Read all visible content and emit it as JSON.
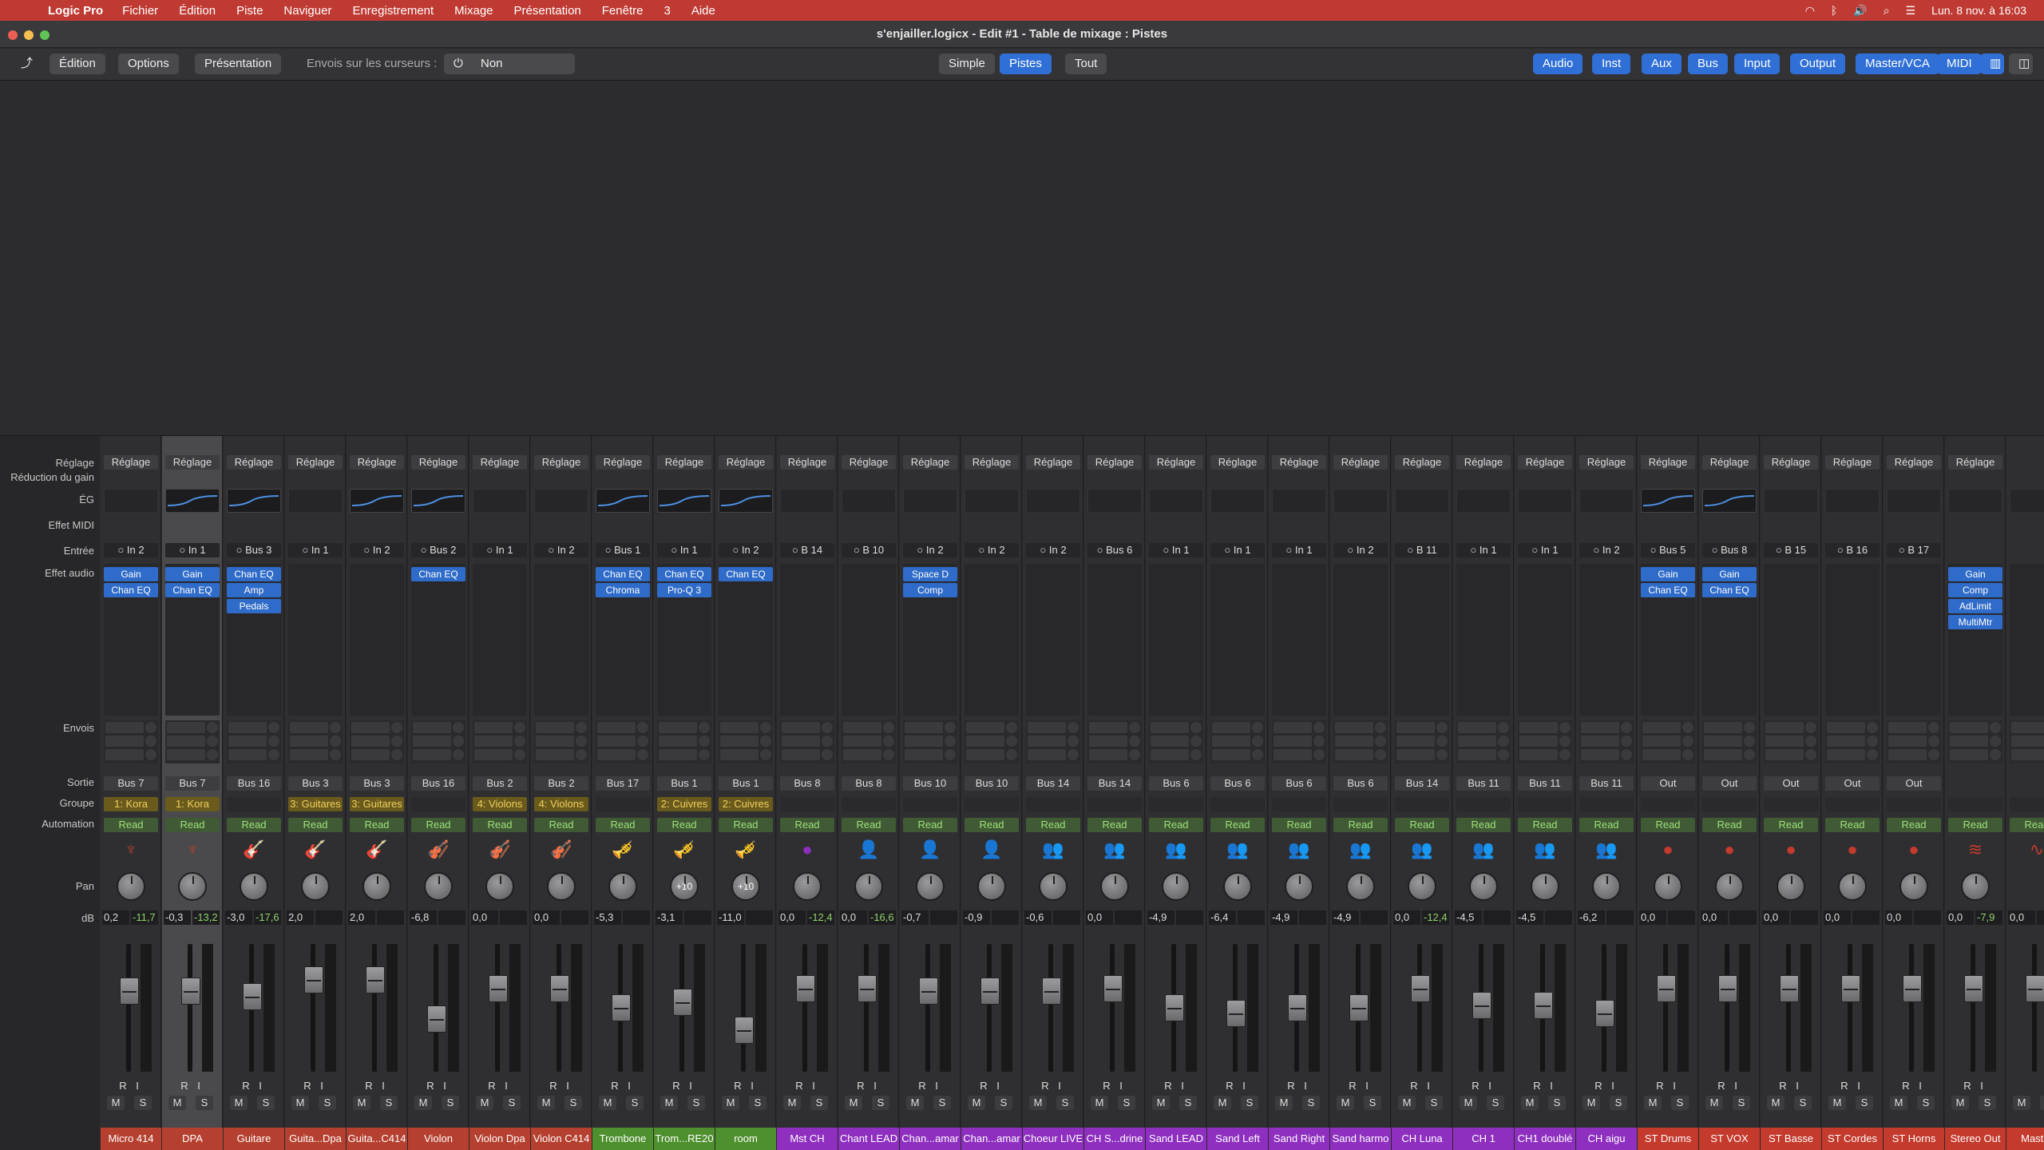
{
  "menubar": {
    "app": "Logic Pro",
    "items": [
      "Fichier",
      "Édition",
      "Piste",
      "Naviguer",
      "Enregistrement",
      "Mixage",
      "Présentation",
      "Fenêtre",
      "3",
      "Aide"
    ],
    "clock": "Lun. 8 nov. à 16:03"
  },
  "window": {
    "title": "s'enjailler.logicx - Edit #1 - Table de mixage : Pistes"
  },
  "toolbar": {
    "edition": "Édition",
    "options": "Options",
    "presentation": "Présentation",
    "sends_label": "Envois sur les curseurs :",
    "sends_value": "Non",
    "view_simple": "Simple",
    "view_pistes": "Pistes",
    "view_tout": "Tout",
    "filters": [
      "Audio",
      "Inst",
      "Aux",
      "Bus",
      "Input",
      "Output",
      "Master/VCA",
      "MIDI"
    ]
  },
  "row_labels": {
    "reglage": "Réglage",
    "reduction": "Réduction du gain",
    "eg": "ÉG",
    "effet_midi": "Effet MIDI",
    "entree": "Entrée",
    "effet_audio": "Effet audio",
    "envois": "Envois",
    "sortie": "Sortie",
    "groupe": "Groupe",
    "automation": "Automation",
    "pan": "Pan",
    "db": "dB"
  },
  "strips": [
    {
      "name": "Micro 414",
      "setting": "Réglage",
      "input": "In 2",
      "plugins": [
        "Gain",
        "Chan EQ"
      ],
      "output": "Bus 7",
      "group": "1: Kora",
      "auto": "Read",
      "icon": "kora-icon",
      "glyph": "♆",
      "pan": "",
      "db": "0,2",
      "peak": "-11,7",
      "fader": 0.7,
      "color": "#b5402f",
      "eq": false
    },
    {
      "name": "DPA",
      "setting": "Réglage",
      "input": "In 1",
      "plugins": [
        "Gain",
        "Chan EQ"
      ],
      "output": "Bus 7",
      "group": "1: Kora",
      "auto": "Read",
      "icon": "kora-icon",
      "glyph": "♆",
      "pan": "",
      "db": "-0,3",
      "peak": "-13,2",
      "fader": 0.7,
      "color": "#b5402f",
      "eq": true,
      "selected": true
    },
    {
      "name": "Guitare",
      "setting": "Réglage",
      "input": "Bus 3",
      "plugins": [
        "Chan EQ",
        "Amp",
        "Pedals"
      ],
      "output": "Bus 16",
      "group": "",
      "auto": "Read",
      "icon": "guitar-icon",
      "glyph": "🎸",
      "pan": "",
      "db": "-3,0",
      "peak": "-17,6",
      "fader": 0.65,
      "color": "#b5402f",
      "eq": true
    },
    {
      "name": "Guita...Dpa",
      "setting": "Réglage",
      "input": "In 1",
      "plugins": [],
      "output": "Bus 3",
      "group": "3: Guitares",
      "auto": "Read",
      "icon": "guitar-icon",
      "glyph": "🎸",
      "pan": "",
      "db": "2,0",
      "peak": "",
      "fader": 0.8,
      "color": "#b5402f",
      "eq": false
    },
    {
      "name": "Guita...C414",
      "setting": "Réglage",
      "input": "In 2",
      "plugins": [],
      "output": "Bus 3",
      "group": "3: Guitares",
      "auto": "Read",
      "icon": "guitar-icon",
      "glyph": "🎸",
      "pan": "",
      "db": "2,0",
      "peak": "",
      "fader": 0.8,
      "color": "#b5402f",
      "eq": true
    },
    {
      "name": "Violon",
      "setting": "Réglage",
      "input": "Bus 2",
      "plugins": [
        "Chan EQ"
      ],
      "output": "Bus 16",
      "group": "",
      "auto": "Read",
      "icon": "violin-icon",
      "glyph": "🎻",
      "pan": "",
      "db": "-6,8",
      "peak": "",
      "fader": 0.45,
      "color": "#b5402f",
      "eq": true
    },
    {
      "name": "Violon Dpa",
      "setting": "Réglage",
      "input": "In 1",
      "plugins": [],
      "output": "Bus 2",
      "group": "4: Violons",
      "auto": "Read",
      "icon": "violin-icon",
      "glyph": "🎻",
      "pan": "",
      "db": "0,0",
      "peak": "",
      "fader": 0.72,
      "color": "#b5402f",
      "eq": false
    },
    {
      "name": "Violon C414",
      "setting": "Réglage",
      "input": "In 2",
      "plugins": [],
      "output": "Bus 2",
      "group": "4: Violons",
      "auto": "Read",
      "icon": "violin-icon",
      "glyph": "🎻",
      "pan": "",
      "db": "0,0",
      "peak": "",
      "fader": 0.72,
      "color": "#b5402f",
      "eq": false
    },
    {
      "name": "Trombone",
      "setting": "Réglage",
      "input": "Bus 1",
      "plugins": [
        "Chan EQ",
        "Chroma"
      ],
      "output": "Bus 17",
      "group": "",
      "auto": "Read",
      "icon": "trombone-icon",
      "glyph": "🎺",
      "pan": "",
      "db": "-5,3",
      "peak": "",
      "fader": 0.55,
      "color": "#4e8f2e",
      "eq": true
    },
    {
      "name": "Trom...RE20",
      "setting": "Réglage",
      "input": "In 1",
      "plugins": [
        "Chan EQ",
        "Pro-Q 3"
      ],
      "output": "Bus 1",
      "group": "2: Cuivres",
      "auto": "Read",
      "icon": "trombone-icon",
      "glyph": "🎺",
      "pan": "+10",
      "db": "-3,1",
      "peak": "",
      "fader": 0.6,
      "color": "#4e8f2e",
      "eq": true
    },
    {
      "name": "room",
      "setting": "Réglage",
      "input": "In 2",
      "plugins": [
        "Chan EQ"
      ],
      "output": "Bus 1",
      "group": "2: Cuivres",
      "auto": "Read",
      "icon": "trombone-icon",
      "glyph": "🎺",
      "pan": "+10",
      "db": "-11,0",
      "peak": "",
      "fader": 0.35,
      "color": "#4e8f2e",
      "eq": true
    },
    {
      "name": "Mst CH",
      "setting": "Réglage",
      "input": "B 14",
      "plugins": [],
      "output": "Bus 8",
      "group": "",
      "auto": "Read",
      "icon": "bus-knob-icon",
      "glyph": "●",
      "pan": "",
      "db": "0,0",
      "peak": "-12,4",
      "fader": 0.72,
      "color": "#8e2fbf",
      "eq": false
    },
    {
      "name": "Chant LEAD",
      "setting": "Réglage",
      "input": "B 10",
      "plugins": [],
      "output": "Bus 8",
      "group": "",
      "auto": "Read",
      "icon": "singer-icon",
      "glyph": "👤",
      "pan": "",
      "db": "0,0",
      "peak": "-16,6",
      "fader": 0.72,
      "color": "#8e2fbf",
      "eq": false
    },
    {
      "name": "Chan...amar",
      "setting": "Réglage",
      "input": "In 2",
      "plugins": [
        "Space D",
        "Comp"
      ],
      "output": "Bus 10",
      "group": "",
      "auto": "Read",
      "icon": "singer-icon",
      "glyph": "👤",
      "pan": "",
      "db": "-0,7",
      "peak": "",
      "fader": 0.7,
      "color": "#8e2fbf",
      "eq": false
    },
    {
      "name": "Chan...amar",
      "setting": "Réglage",
      "input": "In 2",
      "plugins": [],
      "output": "Bus 10",
      "group": "",
      "auto": "Read",
      "icon": "singer-icon",
      "glyph": "👤",
      "pan": "",
      "db": "-0,9",
      "peak": "",
      "fader": 0.7,
      "color": "#8e2fbf",
      "eq": false
    },
    {
      "name": "Choeur LIVE",
      "setting": "Réglage",
      "input": "In 2",
      "plugins": [],
      "output": "Bus 14",
      "group": "",
      "auto": "Read",
      "icon": "choir-icon",
      "glyph": "👥",
      "pan": "",
      "db": "-0,6",
      "peak": "",
      "fader": 0.7,
      "color": "#8e2fbf",
      "eq": false
    },
    {
      "name": "CH S...drine",
      "setting": "Réglage",
      "input": "Bus 6",
      "plugins": [],
      "output": "Bus 14",
      "group": "",
      "auto": "Read",
      "icon": "choir-icon",
      "glyph": "👥",
      "pan": "",
      "db": "0,0",
      "peak": "",
      "fader": 0.72,
      "color": "#8e2fbf",
      "eq": false
    },
    {
      "name": "Sand LEAD",
      "setting": "Réglage",
      "input": "In 1",
      "plugins": [],
      "output": "Bus 6",
      "group": "",
      "auto": "Read",
      "icon": "choir-icon",
      "glyph": "👥",
      "pan": "",
      "db": "-4,9",
      "peak": "",
      "fader": 0.55,
      "color": "#8e2fbf",
      "eq": false
    },
    {
      "name": "Sand Left",
      "setting": "Réglage",
      "input": "In 1",
      "plugins": [],
      "output": "Bus 6",
      "group": "",
      "auto": "Read",
      "icon": "choir-icon",
      "glyph": "👥",
      "pan": "",
      "db": "-6,4",
      "peak": "",
      "fader": 0.5,
      "color": "#8e2fbf",
      "eq": false
    },
    {
      "name": "Sand Right",
      "setting": "Réglage",
      "input": "In 1",
      "plugins": [],
      "output": "Bus 6",
      "group": "",
      "auto": "Read",
      "icon": "choir-icon",
      "glyph": "👥",
      "pan": "",
      "db": "-4,9",
      "peak": "",
      "fader": 0.55,
      "color": "#8e2fbf",
      "eq": false
    },
    {
      "name": "Sand harmo",
      "setting": "Réglage",
      "input": "In 2",
      "plugins": [],
      "output": "Bus 6",
      "group": "",
      "auto": "Read",
      "icon": "choir-icon",
      "glyph": "👥",
      "pan": "",
      "db": "-4,9",
      "peak": "",
      "fader": 0.55,
      "color": "#8e2fbf",
      "eq": false
    },
    {
      "name": "CH Luna",
      "setting": "Réglage",
      "input": "B 11",
      "plugins": [],
      "output": "Bus 14",
      "group": "",
      "auto": "Read",
      "icon": "choir-icon",
      "glyph": "👥",
      "pan": "",
      "db": "0,0",
      "peak": "-12,4",
      "fader": 0.72,
      "color": "#8e2fbf",
      "eq": false
    },
    {
      "name": "CH 1",
      "setting": "Réglage",
      "input": "In 1",
      "plugins": [],
      "output": "Bus 11",
      "group": "",
      "auto": "Read",
      "icon": "choir-icon",
      "glyph": "👥",
      "pan": "",
      "db": "-4,5",
      "peak": "",
      "fader": 0.57,
      "color": "#8e2fbf",
      "eq": false
    },
    {
      "name": "CH1 doublé",
      "setting": "Réglage",
      "input": "In 1",
      "plugins": [],
      "output": "Bus 11",
      "group": "",
      "auto": "Read",
      "icon": "choir-icon",
      "glyph": "👥",
      "pan": "",
      "db": "-4,5",
      "peak": "",
      "fader": 0.57,
      "color": "#8e2fbf",
      "eq": false
    },
    {
      "name": "CH aigu",
      "setting": "Réglage",
      "input": "In 2",
      "plugins": [],
      "output": "Bus 11",
      "group": "",
      "auto": "Read",
      "icon": "choir-icon",
      "glyph": "👥",
      "pan": "",
      "db": "-6,2",
      "peak": "",
      "fader": 0.5,
      "color": "#8e2fbf",
      "eq": false
    },
    {
      "name": "ST Drums",
      "setting": "Réglage",
      "input": "Bus 5",
      "plugins": [
        "Gain",
        "Chan EQ"
      ],
      "output": "Out",
      "group": "",
      "auto": "Read",
      "icon": "bus-knob-icon",
      "glyph": "●",
      "pan": "",
      "db": "0,0",
      "peak": "",
      "fader": 0.72,
      "color": "#c43a2c",
      "eq": true
    },
    {
      "name": "ST VOX",
      "setting": "Réglage",
      "input": "Bus 8",
      "plugins": [
        "Gain",
        "Chan EQ"
      ],
      "output": "Out",
      "group": "",
      "auto": "Read",
      "icon": "bus-knob-icon",
      "glyph": "●",
      "pan": "",
      "db": "0,0",
      "peak": "",
      "fader": 0.72,
      "color": "#c43a2c",
      "eq": true
    },
    {
      "name": "ST Basse",
      "setting": "Réglage",
      "input": "B 15",
      "plugins": [],
      "output": "Out",
      "group": "",
      "auto": "Read",
      "icon": "bus-knob-icon",
      "glyph": "●",
      "pan": "",
      "db": "0,0",
      "peak": "",
      "fader": 0.72,
      "color": "#c43a2c",
      "eq": false
    },
    {
      "name": "ST Cordes",
      "setting": "Réglage",
      "input": "B 16",
      "plugins": [],
      "output": "Out",
      "group": "",
      "auto": "Read",
      "icon": "bus-knob-icon",
      "glyph": "●",
      "pan": "",
      "db": "0,0",
      "peak": "",
      "fader": 0.72,
      "color": "#c43a2c",
      "eq": false
    },
    {
      "name": "ST Horns",
      "setting": "Réglage",
      "input": "B 17",
      "plugins": [],
      "output": "Out",
      "group": "",
      "auto": "Read",
      "icon": "bus-knob-icon",
      "glyph": "●",
      "pan": "",
      "db": "0,0",
      "peak": "",
      "fader": 0.72,
      "color": "#c43a2c",
      "eq": false
    },
    {
      "name": "Stereo Out",
      "setting": "Réglage",
      "input": "",
      "plugins": [
        "Gain",
        "Comp",
        "AdLimit",
        "MultiMtr"
      ],
      "output": "",
      "group": "",
      "auto": "Read",
      "icon": "stereo-out-icon",
      "glyph": "≋",
      "pan": "",
      "db": "0,0",
      "peak": "-7,9",
      "fader": 0.72,
      "color": "#c43a2c",
      "eq": false
    },
    {
      "name": "Master",
      "setting": "",
      "input": "",
      "plugins": [],
      "output": "",
      "group": "",
      "auto": "Read",
      "icon": "master-icon",
      "glyph": "∿",
      "pan": "",
      "db": "0,0",
      "peak": "",
      "fader": 0.72,
      "color": "#c43a2c",
      "eq": false,
      "master": true
    }
  ]
}
